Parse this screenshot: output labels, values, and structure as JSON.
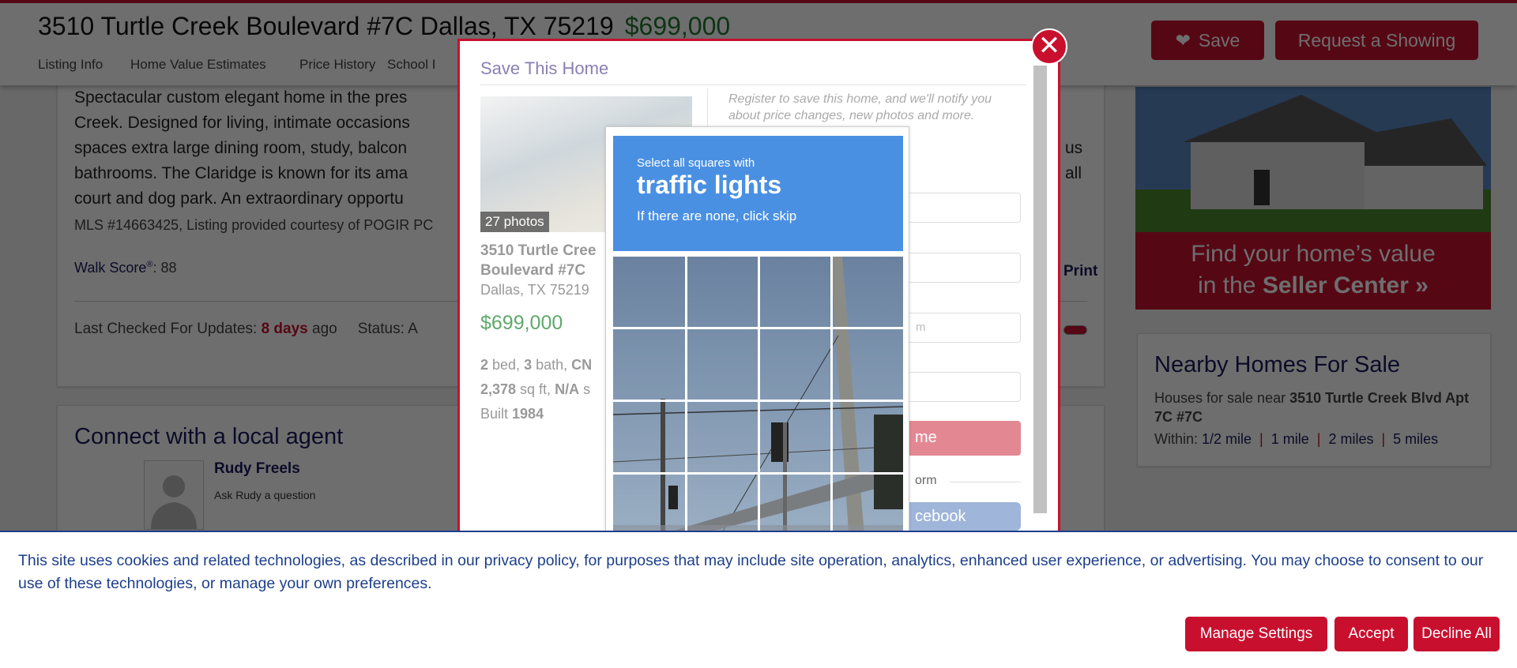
{
  "header": {
    "address": "3510 Turtle Creek Boulevard #7C Dallas, TX 75219",
    "price": "$699,000",
    "tabs": [
      "Listing Info",
      "Home Value Estimates",
      "Price History",
      "School I"
    ],
    "save_label": "Save",
    "request_label": "Request a Showing"
  },
  "listing": {
    "desc_lines": [
      "Spectacular custom elegant home in the pres",
      "Creek. Designed for living, intimate occasions",
      "spaces extra large dining room, study, balcon",
      "bathrooms. The Claridge is known for its ama",
      "court and dog park. An extraordinary opportu"
    ],
    "desc_right": [
      "us",
      "all"
    ],
    "mls": "MLS #14663425, Listing provided courtesy of POGIR PC",
    "walk_label": "Walk Score",
    "walk_reg": "®",
    "walk_value": ": 88",
    "print": "Print",
    "last_checked_label": "Last Checked For Updates: ",
    "last_checked_value": "8 days",
    "last_checked_suffix": " ago",
    "status": "Status: A"
  },
  "agent": {
    "heading": "Connect with a local agent",
    "name": "Rudy Freels",
    "ask": "Ask Rudy a question"
  },
  "seller_banner": {
    "line1": "Find your home’s value",
    "line2_pre": "in the ",
    "line2_bold": "Seller Center »"
  },
  "nearby": {
    "heading": "Nearby Homes For Sale",
    "text_pre": "Houses for sale near ",
    "text_bold": "3510 Turtle Creek Blvd Apt 7C #7C",
    "within": "Within: ",
    "options": [
      "1/2 mile",
      "1 mile",
      "2 miles",
      "5 miles"
    ]
  },
  "modal": {
    "title": "Save This Home",
    "photos": "27 photos",
    "addr1": "3510 Turtle Cree",
    "addr2": "Boulevard #7C",
    "city": "Dallas, TX 75219",
    "price": "$699,000",
    "beds": "2",
    "bath": "3",
    "type": "CN",
    "sqft": "2,378",
    "lot": "N/A",
    "built": "1984",
    "bed_lbl": " bed, ",
    "bath_lbl": " bath, ",
    "sqft_lbl": " sq ft, ",
    "lot_lbl": " s",
    "built_lbl": "Built ",
    "register": "Register to save this home, and we'll notify you about price changes, new photos and more.",
    "placeholder3": "m",
    "submit": "me",
    "or": "orm",
    "facebook": "cebook"
  },
  "captcha": {
    "line1": "Select all squares with",
    "target": "traffic lights",
    "line3": "If there are none, click skip"
  },
  "cookie": {
    "text": "This site uses cookies and related technologies, as described in our privacy policy, for purposes that may include site operation, analytics, enhanced user experience, or advertising. You may choose to consent to our use of these technologies, or manage your own preferences.",
    "manage": "Manage Settings",
    "accept": "Accept",
    "decline": "Decline All"
  },
  "colors": {
    "brand": "#c8102e",
    "captcha_blue": "#4a90e2",
    "price_green": "#5fa86a"
  }
}
